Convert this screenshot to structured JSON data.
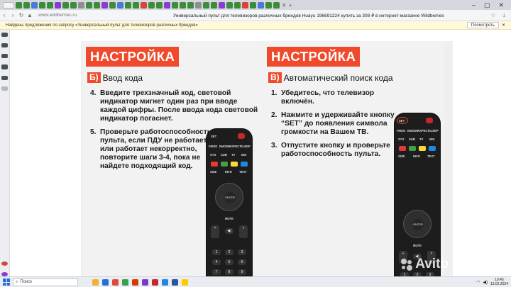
{
  "browser": {
    "url": "www.wildberries.ru",
    "page_title": "Универсальный пульт для телевизоров различных брендов Huayu 196691224 купить за 308 ₽ в интернет-магазине Wildberries",
    "infobar_text": "Найдены предложения по запросу «Универсальный пульт для телевизоров различных брендов»",
    "infobar_button": "Посмотреть"
  },
  "left_panel": {
    "heading": "НАСТРОЙКА",
    "sub_letter": "Б)",
    "sub_text": "Ввод кода",
    "steps": [
      {
        "n": "4.",
        "text": "Введите трехзначный код, световой\nиндикатор мигнет один раз при вводе\nкаждой цифры. После ввода кода световой\nиндикатор погаснет."
      },
      {
        "n": "5.",
        "text": "Проверьте работоспособность\nпульта, если ПДУ не работает\nили работает некорректно,\nповторите шаги 3-4, пока не\nнайдете подходящий код."
      }
    ]
  },
  "right_panel": {
    "heading": "НАСТРОЙКА",
    "sub_letter": "В)",
    "sub_text": "Автоматический поиск кода",
    "steps": [
      {
        "n": "1.",
        "text": "Убедитесь, что телевизор включён."
      },
      {
        "n": "2.",
        "text": "Нажмите и удерживайте кнопку\n“SET” до появления символа\nгромкости на Вашем ТВ."
      },
      {
        "n": "3.",
        "text": "Отпустите кнопку и проверьте\nработоспособность пульта."
      }
    ]
  },
  "remote": {
    "set": "SET",
    "row1": [
      "FMOD",
      "EMODE",
      "ASPECT",
      "SLEEP"
    ],
    "row2": [
      "SYS",
      "SUB",
      "TV",
      "MIX"
    ],
    "row3": [
      "SIZE",
      "INFO",
      "TEXT"
    ],
    "enter": "ENTER",
    "mute": "MUTE",
    "numbers": [
      "1",
      "2",
      "3",
      "4",
      "5",
      "6",
      "7",
      "8",
      "9"
    ],
    "key_colors": [
      "#e53935",
      "#43a047",
      "#fdd835",
      "#1e88e5"
    ]
  },
  "watermark": "Avito",
  "taskbar": {
    "search_placeholder": "Поиск",
    "time": "10:45",
    "date": "13.02.2024"
  }
}
